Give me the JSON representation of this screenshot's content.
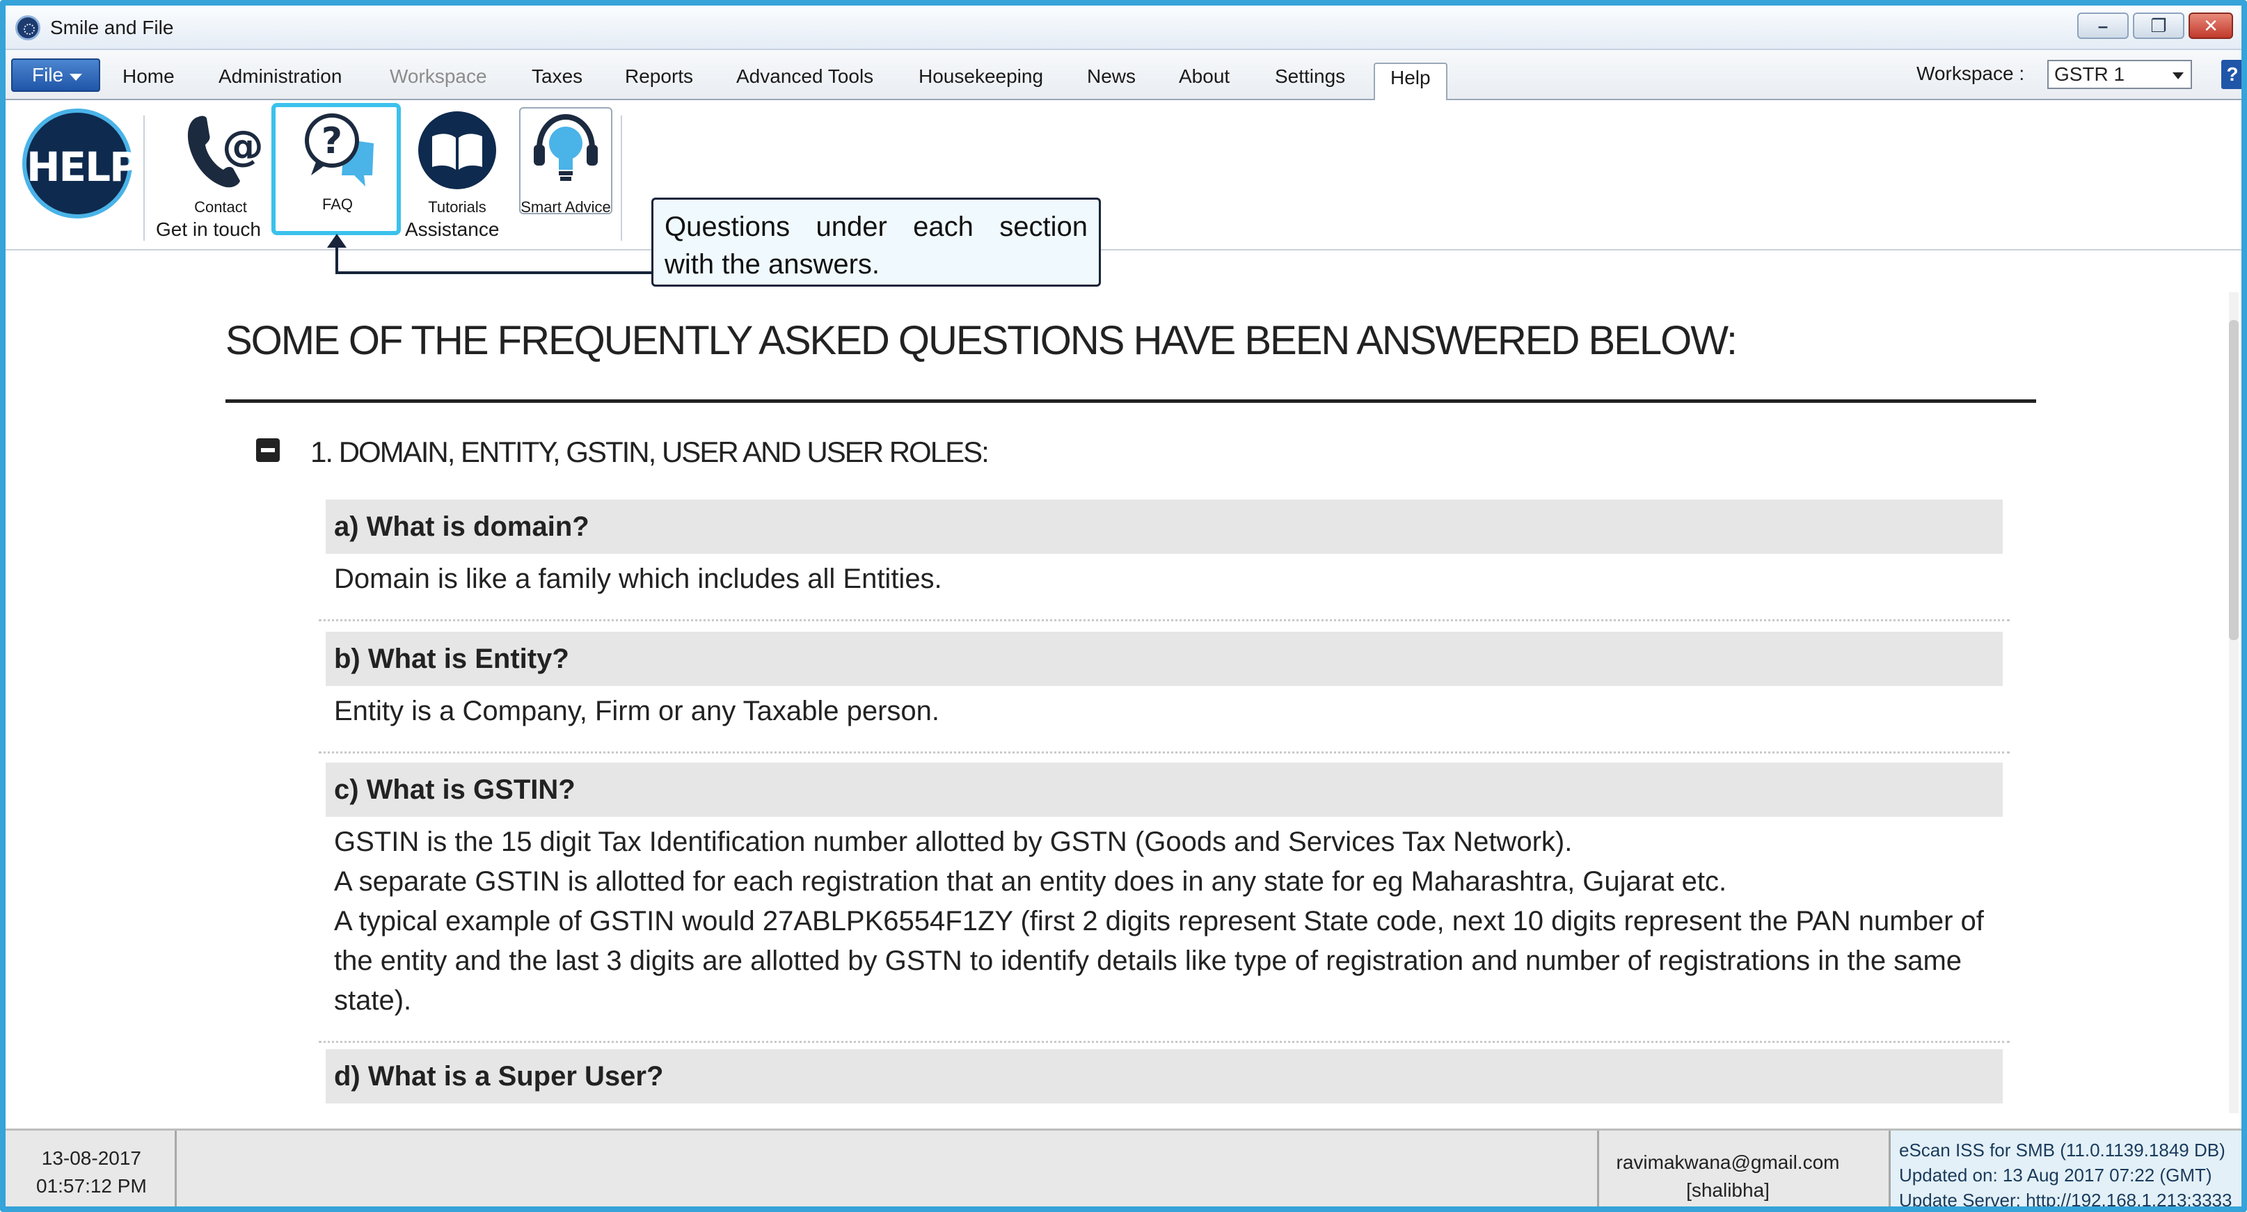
{
  "window": {
    "title": "Smile and File"
  },
  "menu": {
    "file": "File",
    "items": [
      "Home",
      "Administration",
      "Workspace",
      "Taxes",
      "Reports",
      "Advanced Tools",
      "Housekeeping",
      "News",
      "About",
      "Settings",
      "Help"
    ],
    "active": "Help",
    "disabled": [
      "Workspace"
    ],
    "workspace_label": "Workspace :",
    "workspace_value": "GSTR 1"
  },
  "ribbon": {
    "help_badge": "HELP",
    "tools": {
      "contact": "Contact",
      "faq": "FAQ",
      "tutorials": "Tutorials",
      "smart_advice": "Smart Advice"
    },
    "groups": {
      "get_in_touch": "Get in touch",
      "assistance": "Assistance"
    }
  },
  "callout": {
    "line1": "Questions under each section",
    "line2": "with the answers."
  },
  "faq": {
    "heading": "SOME OF THE FREQUENTLY ASKED QUESTIONS HAVE BEEN ANSWERED BELOW:",
    "section_title": "1. DOMAIN, ENTITY, GSTIN, USER AND USER ROLES:",
    "questions": [
      {
        "q": "a) What is domain?",
        "a": [
          "Domain is like a family which includes all Entities."
        ]
      },
      {
        "q": "b) What is Entity?",
        "a": [
          "Entity is a Company, Firm or any Taxable person."
        ]
      },
      {
        "q": "c) What is GSTIN?",
        "a": [
          "GSTIN is the 15 digit Tax Identification number allotted by GSTN (Goods and Services Tax Network).",
          "A separate GSTIN is allotted for each registration that an entity does in any state for eg Maharashtra, Gujarat etc.",
          "A typical example of GSTIN would 27ABLPK6554F1ZY (first 2 digits represent State code, next 10 digits represent the PAN number of",
          "the entity and the last 3 digits are allotted by GSTN to identify details like type of registration and number of registrations in the same",
          "state)."
        ]
      },
      {
        "q": "d) What is a Super User?",
        "a": []
      }
    ]
  },
  "status": {
    "date": "13-08-2017",
    "time": "01:57:12 PM",
    "email": "ravimakwana@gmail.com",
    "user": "[shalibha]",
    "escan_line1": "eScan ISS for SMB (11.0.1139.1849 DB)",
    "escan_line2": "Updated on: 13 Aug 2017 07:22 (GMT)",
    "escan_line3": "Update Server: http://192.168.1.213:3333"
  }
}
